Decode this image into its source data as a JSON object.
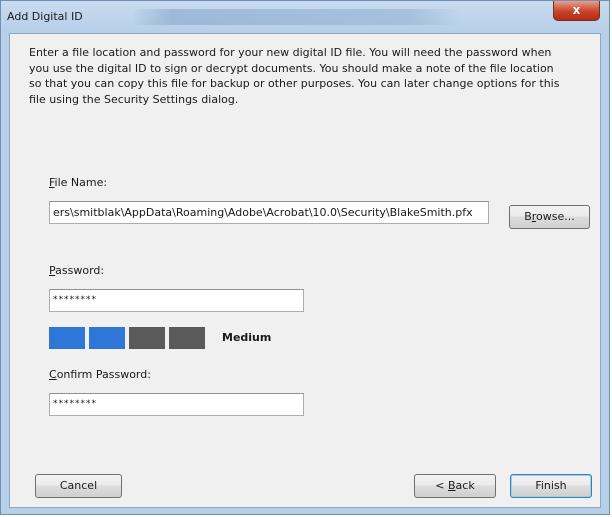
{
  "window": {
    "title": "Add Digital ID",
    "close_glyph": "x"
  },
  "intro_text": "Enter a file location and password for your new digital ID file. You will need the password when you use the digital ID to sign or decrypt documents. You should make a note of the file location so that you can copy this file for backup or other purposes. You can later change options for this file using the Security Settings dialog.",
  "file_name": {
    "label_pre": "",
    "label_mnemonic": "F",
    "label_post": "ile Name:",
    "value": "ers\\smitblak\\AppData\\Roaming\\Adobe\\Acrobat\\10.0\\Security\\BlakeSmith.pfx",
    "browse_pre": "B",
    "browse_mnemonic": "r",
    "browse_post": "owse..."
  },
  "password": {
    "label_pre": "",
    "label_mnemonic": "P",
    "label_post": "assword:",
    "value": "********"
  },
  "strength": {
    "segments_total": 4,
    "segments_filled": 2,
    "filled_color": "#2f77d6",
    "empty_color": "#5a5a5a",
    "label": "Medium"
  },
  "confirm_password": {
    "label_pre": "",
    "label_mnemonic": "C",
    "label_post": "onfirm Password:",
    "value": "********"
  },
  "buttons": {
    "cancel": "Cancel",
    "back_pre": "< ",
    "back_mnemonic": "B",
    "back_post": "ack",
    "finish": "Finish"
  }
}
